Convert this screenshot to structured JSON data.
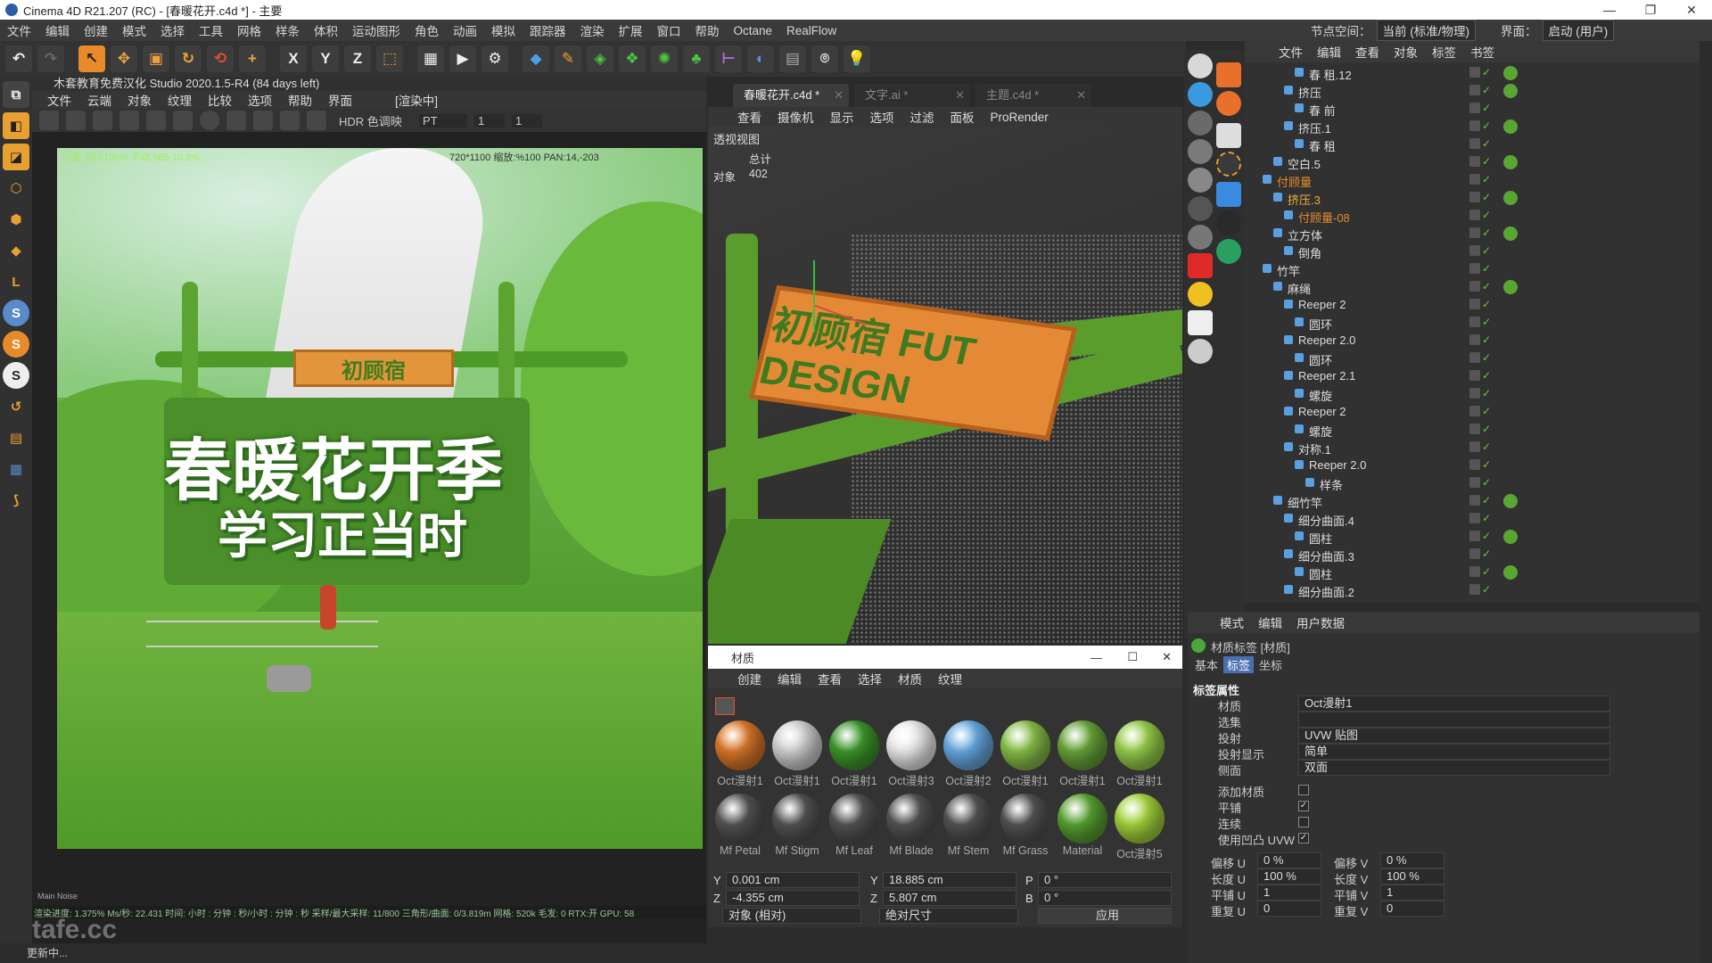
{
  "window": {
    "title": "Cinema 4D R21.207 (RC) - [春暖花开.c4d *] - 主要"
  },
  "menubar": {
    "items": [
      "文件",
      "编辑",
      "创建",
      "模式",
      "选择",
      "工具",
      "网格",
      "样条",
      "体积",
      "运动图形",
      "角色",
      "动画",
      "模拟",
      "跟踪器",
      "渲染",
      "扩展",
      "窗口",
      "帮助",
      "Octane",
      "RealFlow"
    ],
    "node_space_label": "节点空间：",
    "node_space_value": "当前 (标准/物理)",
    "interface_label": "界面：",
    "interface_value": "启动 (用户)"
  },
  "toolbar": {
    "icons": [
      "undo-icon",
      "redo-icon",
      "select-icon",
      "move-icon",
      "scale-icon",
      "rotate-icon",
      "recent-tool-icon",
      "add-icon",
      "x-axis-icon",
      "y-axis-icon",
      "z-axis-icon",
      "coord-icon",
      "render-region-icon",
      "render-view-icon",
      "render-settings-icon",
      "cube-icon",
      "pen-icon",
      "subdivide-icon",
      "array-icon",
      "cloner-icon",
      "hierarchy-icon",
      "deformer-icon",
      "field-icon",
      "floor-icon",
      "camera-icon",
      "light-icon"
    ],
    "axis_labels": [
      "X",
      "Y",
      "Z"
    ]
  },
  "left_viewport": {
    "header": "木套教育免费汉化 Studio 2020.1.5-R4 (84 days left)",
    "menu": [
      "文件",
      "云端",
      "对象",
      "纹理",
      "比较",
      "选项",
      "帮助",
      "界面"
    ],
    "render_status": "[渲染中]",
    "tonemap": "HDR 色调映",
    "kernel": "PT",
    "val1": "1",
    "val2": "1",
    "info_left": "三维_Gl.619cm 不动.585 10.8%…",
    "info_right": "720*1100 缩放:%100 PAN:14,-203",
    "sign_text": "初顾宿",
    "headline1": "春暖花开季",
    "headline2": "学习正当时",
    "statusline": "渲染进度: 1.375%   Ms/秒: 22.431   时间: 小时 : 分钟 : 秒/小时 : 分钟 : 秒   采样/最大采样: 11/800   三角形/曲面: 0/3.819m   网格: 520k   毛发: 0   RTX:开   GPU: 58",
    "minitabs": "Main  Noise",
    "watermark": "tafe.cc",
    "bottom_status": "更新中..."
  },
  "main_viewport": {
    "tabs": [
      {
        "label": "春暖花开.c4d *",
        "active": true
      },
      {
        "label": "文字.ai *",
        "active": false
      },
      {
        "label": "主题.c4d *",
        "active": false
      }
    ],
    "menu": [
      "查看",
      "摄像机",
      "显示",
      "选项",
      "过滤",
      "面板",
      "ProRender"
    ],
    "view_name": "透视视图",
    "stats_label": "总计",
    "objects_label": "对象",
    "objects_count": "402",
    "sign_text": "初顾宿 FUT DESIGN"
  },
  "material_manager": {
    "title": "材质",
    "menu": [
      "创建",
      "编辑",
      "查看",
      "选择",
      "材质",
      "纹理"
    ],
    "materials": [
      {
        "name": "Oct漫射1",
        "color": "#e07a2a"
      },
      {
        "name": "Oct漫射1",
        "color": "#d6d6d6"
      },
      {
        "name": "Oct漫射1",
        "color": "#3e9b2c"
      },
      {
        "name": "Oct漫射3",
        "color": "#f0f0f0"
      },
      {
        "name": "Oct漫射2",
        "color": "#6aaee8"
      },
      {
        "name": "Oct漫射1",
        "color": "#8cc44a"
      },
      {
        "name": "Oct漫射1",
        "color": "#6aa83a"
      },
      {
        "name": "Oct漫射1",
        "color": "#9ad24c"
      },
      {
        "name": "Mf Petal",
        "color": "#555555"
      },
      {
        "name": "Mf Stigm",
        "color": "#555555"
      },
      {
        "name": "Mf Leaf",
        "color": "#555555"
      },
      {
        "name": "Mf Blade",
        "color": "#555555"
      },
      {
        "name": "Mf Stem",
        "color": "#555555"
      },
      {
        "name": "Mf Grass",
        "color": "#555555"
      },
      {
        "name": "Material",
        "color": "#5aa632"
      },
      {
        "name": "Oct漫射5",
        "color": "#a8d83c"
      }
    ]
  },
  "coordinates": {
    "y_label": "Y",
    "y_val": "0.001 cm",
    "z_label": "Z",
    "z_val": "-4.355 cm",
    "y2_label": "Y",
    "y2_val": "18.885 cm",
    "z2_label": "Z",
    "z2_val": "5.807 cm",
    "p_label": "P",
    "p_val": "0 °",
    "b_label": "B",
    "b_val": "0 °",
    "mode1": "对象 (相对)",
    "mode2": "绝对尺寸",
    "apply": "应用"
  },
  "object_manager": {
    "menu": [
      "文件",
      "编辑",
      "查看",
      "对象",
      "标签",
      "书签"
    ],
    "rows": [
      {
        "name": "春 租.12",
        "indent": 4,
        "color": "#dddddd",
        "tag": true
      },
      {
        "name": "挤压",
        "indent": 3,
        "color": "#dddddd",
        "tag": true
      },
      {
        "name": "春 前",
        "indent": 4,
        "color": "#dddddd",
        "tag": false
      },
      {
        "name": "挤压.1",
        "indent": 3,
        "color": "#dddddd",
        "tag": true
      },
      {
        "name": "春 租",
        "indent": 4,
        "color": "#dddddd",
        "tag": false
      },
      {
        "name": "空白.5",
        "indent": 2,
        "color": "#dddddd",
        "tag": true
      },
      {
        "name": "付顾量",
        "indent": 1,
        "color": "#e68a2e",
        "tag": false
      },
      {
        "name": "挤压.3",
        "indent": 2,
        "color": "#e8b23a",
        "tag": true
      },
      {
        "name": "付顾量-08",
        "indent": 3,
        "color": "#e68a2e",
        "tag": false
      },
      {
        "name": "立方体",
        "indent": 2,
        "color": "#dddddd",
        "tag": true
      },
      {
        "name": "倒角",
        "indent": 3,
        "color": "#dddddd",
        "tag": false
      },
      {
        "name": "竹竿",
        "indent": 1,
        "color": "#dddddd",
        "tag": false
      },
      {
        "name": "麻绳",
        "indent": 2,
        "color": "#dddddd",
        "tag": true
      },
      {
        "name": "Reeper 2",
        "indent": 3,
        "color": "#dddddd",
        "tag": false
      },
      {
        "name": "圆环",
        "indent": 4,
        "color": "#dddddd",
        "tag": false
      },
      {
        "name": "Reeper 2.0",
        "indent": 3,
        "color": "#dddddd",
        "tag": false
      },
      {
        "name": "圆环",
        "indent": 4,
        "color": "#dddddd",
        "tag": false
      },
      {
        "name": "Reeper 2.1",
        "indent": 3,
        "color": "#dddddd",
        "tag": false
      },
      {
        "name": "螺旋",
        "indent": 4,
        "color": "#dddddd",
        "tag": false
      },
      {
        "name": "Reeper 2",
        "indent": 3,
        "color": "#dddddd",
        "tag": false
      },
      {
        "name": "螺旋",
        "indent": 4,
        "color": "#dddddd",
        "tag": false
      },
      {
        "name": "对称.1",
        "indent": 3,
        "color": "#dddddd",
        "tag": false
      },
      {
        "name": "Reeper 2.0",
        "indent": 4,
        "color": "#dddddd",
        "tag": false
      },
      {
        "name": "样条",
        "indent": 5,
        "color": "#dddddd",
        "tag": false
      },
      {
        "name": "细竹竿",
        "indent": 2,
        "color": "#dddddd",
        "tag": true
      },
      {
        "name": "细分曲面.4",
        "indent": 3,
        "color": "#dddddd",
        "tag": false
      },
      {
        "name": "圆柱",
        "indent": 4,
        "color": "#dddddd",
        "tag": true
      },
      {
        "name": "细分曲面.3",
        "indent": 3,
        "color": "#dddddd",
        "tag": false
      },
      {
        "name": "圆柱",
        "indent": 4,
        "color": "#dddddd",
        "tag": true
      },
      {
        "name": "细分曲面.2",
        "indent": 3,
        "color": "#dddddd",
        "tag": false
      }
    ]
  },
  "attributes": {
    "menu": [
      "模式",
      "编辑",
      "用户数据"
    ],
    "title": "材质标签 [材质]",
    "tabs": [
      "基本",
      "标签",
      "坐标"
    ],
    "section": "标签属性",
    "material_label": "材质",
    "material_value": "Oct漫射1",
    "selection_label": "选集",
    "projection_label": "投射",
    "projection_value": "UVW 贴图",
    "proj_display_label": "投射显示",
    "proj_display_value": "简单",
    "side_label": "侧面",
    "side_value": "双面",
    "add_material_label": "添加材质",
    "tile_label": "平铺",
    "seamless_label": "连续",
    "use_bump_label": "使用凹凸 UVW",
    "offset_u_label": "偏移 U",
    "offset_u_val": "0 %",
    "offset_v_label": "偏移 V",
    "offset_v_val": "0 %",
    "length_u_label": "长度 U",
    "length_u_val": "100 %",
    "length_v_label": "长度 V",
    "length_v_val": "100 %",
    "tile_u_label": "平铺 U",
    "tile_u_val": "1",
    "tile_v_label": "平铺 V",
    "tile_v_val": "1",
    "repeat_u_label": "重复 U",
    "repeat_u_val": "0",
    "repeat_v_label": "重复 V",
    "repeat_v_val": "0"
  },
  "colors": {
    "accent": "#e68a2e",
    "bg": "#313131",
    "green": "#6cc644"
  }
}
